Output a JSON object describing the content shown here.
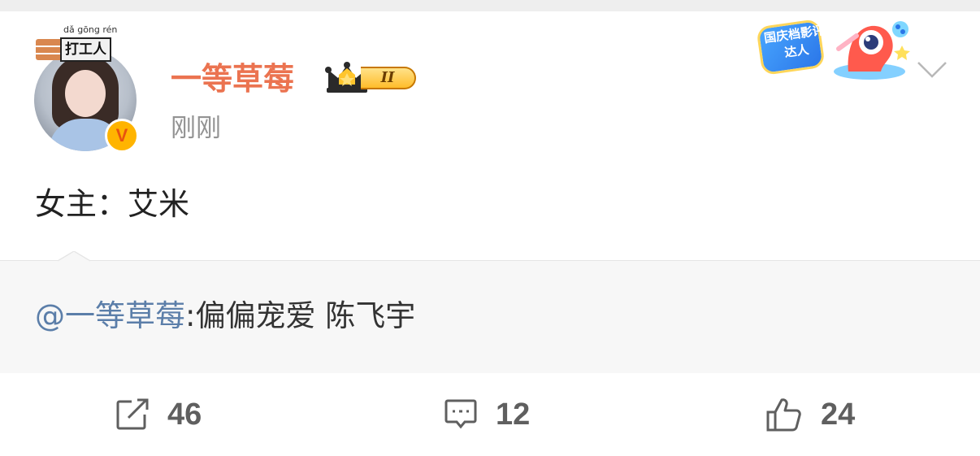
{
  "post": {
    "author": {
      "name": "一等草莓",
      "avatar_nameplate_pinyin": "dǎ gōng rén",
      "avatar_nameplate_label": "打工人",
      "verified_mark": "V",
      "vip_level": "II"
    },
    "time": "刚刚",
    "event_badge_text": "国庆档影评达人",
    "text": "女主：艾米",
    "repost": {
      "author_prefix": "@一等草莓",
      "separator": ":",
      "text": "偏偏宠爱 陈飞宇"
    }
  },
  "actions": {
    "repost": {
      "icon": "share-edit-icon",
      "count": "46"
    },
    "comment": {
      "icon": "comment-icon",
      "count": "12"
    },
    "like": {
      "icon": "thumbs-up-icon",
      "count": "24"
    }
  },
  "colors": {
    "username": "#eb7350",
    "link": "#5b7ea9",
    "muted": "#939393",
    "repost_bg": "#f7f7f7"
  }
}
